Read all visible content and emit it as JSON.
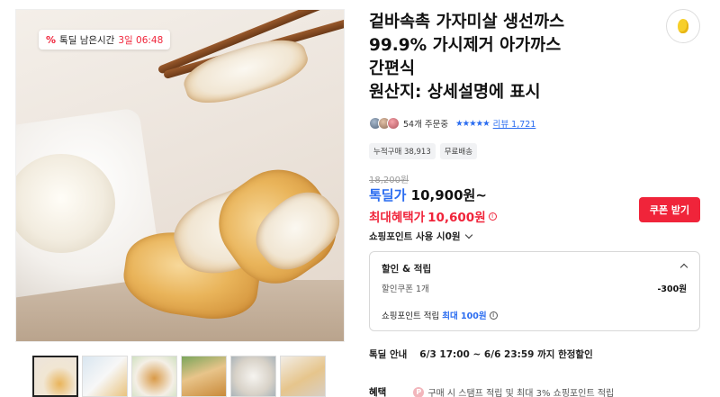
{
  "deal_badge": {
    "icon": "percent-tag-icon",
    "label": "톡딜 남은시간",
    "timer": "3일 06:48"
  },
  "product": {
    "title_lines": [
      "겉바속촉 가자미살 생선까스",
      "99.9% 가시제거 아가까스",
      "간편식",
      "원산지: 상세설명에 표시"
    ]
  },
  "rating": {
    "orders": "54개 주문중",
    "stars": "★★★★★",
    "reviews": "리뷰 1,721"
  },
  "chips": [
    "누적구매 38,913",
    "무료배송"
  ],
  "price": {
    "original": "18,200원",
    "sale_label": "톡딜가",
    "sale_value": "10,900원~",
    "max_label": "최대혜택가",
    "max_value": "10,600원",
    "info_glyph": "i"
  },
  "coupon_button": "쿠폰 받기",
  "points_toggle": "쇼핑포인트 사용 시0원",
  "discount": {
    "header": "할인 & 적립",
    "coupon_label": "할인쿠폰 1개",
    "coupon_value": "-300원",
    "points_label": "쇼핑포인트 적립",
    "points_max": "최대 100원",
    "info_glyph": "i"
  },
  "notice": {
    "label": "톡딜 안내",
    "value": "6/3 17:00 ~ 6/6 23:59 까지 한정할인"
  },
  "benefit": {
    "label": "혜택",
    "icon_glyph": "P",
    "value": "구매 시 스탬프 적립 및 최대 3% 쇼핑포인트 적립"
  },
  "colors": {
    "accent_red": "#f0243a",
    "accent_blue": "#2a6cf0"
  }
}
